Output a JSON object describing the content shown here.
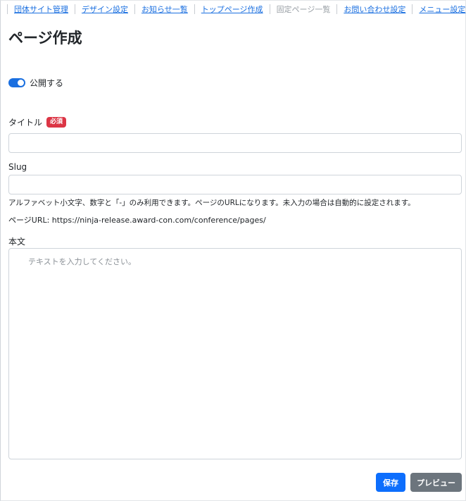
{
  "nav": {
    "items": [
      {
        "label": "団体サイト管理",
        "current": false
      },
      {
        "label": "デザイン設定",
        "current": false
      },
      {
        "label": "お知らせ一覧",
        "current": false
      },
      {
        "label": "トップページ作成",
        "current": false
      },
      {
        "label": "固定ページ一覧",
        "current": true
      },
      {
        "label": "お問い合わせ設定",
        "current": false
      },
      {
        "label": "メニュー設定",
        "current": false
      }
    ]
  },
  "page": {
    "title": "ページ作成"
  },
  "publish": {
    "label": "公開する",
    "checked": true
  },
  "form": {
    "title_label": "タイトル",
    "required_badge": "必須",
    "title_value": "",
    "slug_label": "Slug",
    "slug_value": "",
    "slug_help": "アルファベット小文字、数字と「-」のみ利用できます。ページのURLになります。未入力の場合は自動的に設定されます。",
    "page_url": "ページURL: https://ninja-release.award-con.com/conference/pages/",
    "body_label": "本文",
    "body_placeholder": "テキストを入力してください。"
  },
  "actions": {
    "save_label": "保存",
    "preview_label": "プレビュー"
  },
  "colors": {
    "primary": "#0d6efd",
    "link": "#1a6fe0",
    "danger": "#dc3545",
    "secondary": "#6c757d"
  }
}
